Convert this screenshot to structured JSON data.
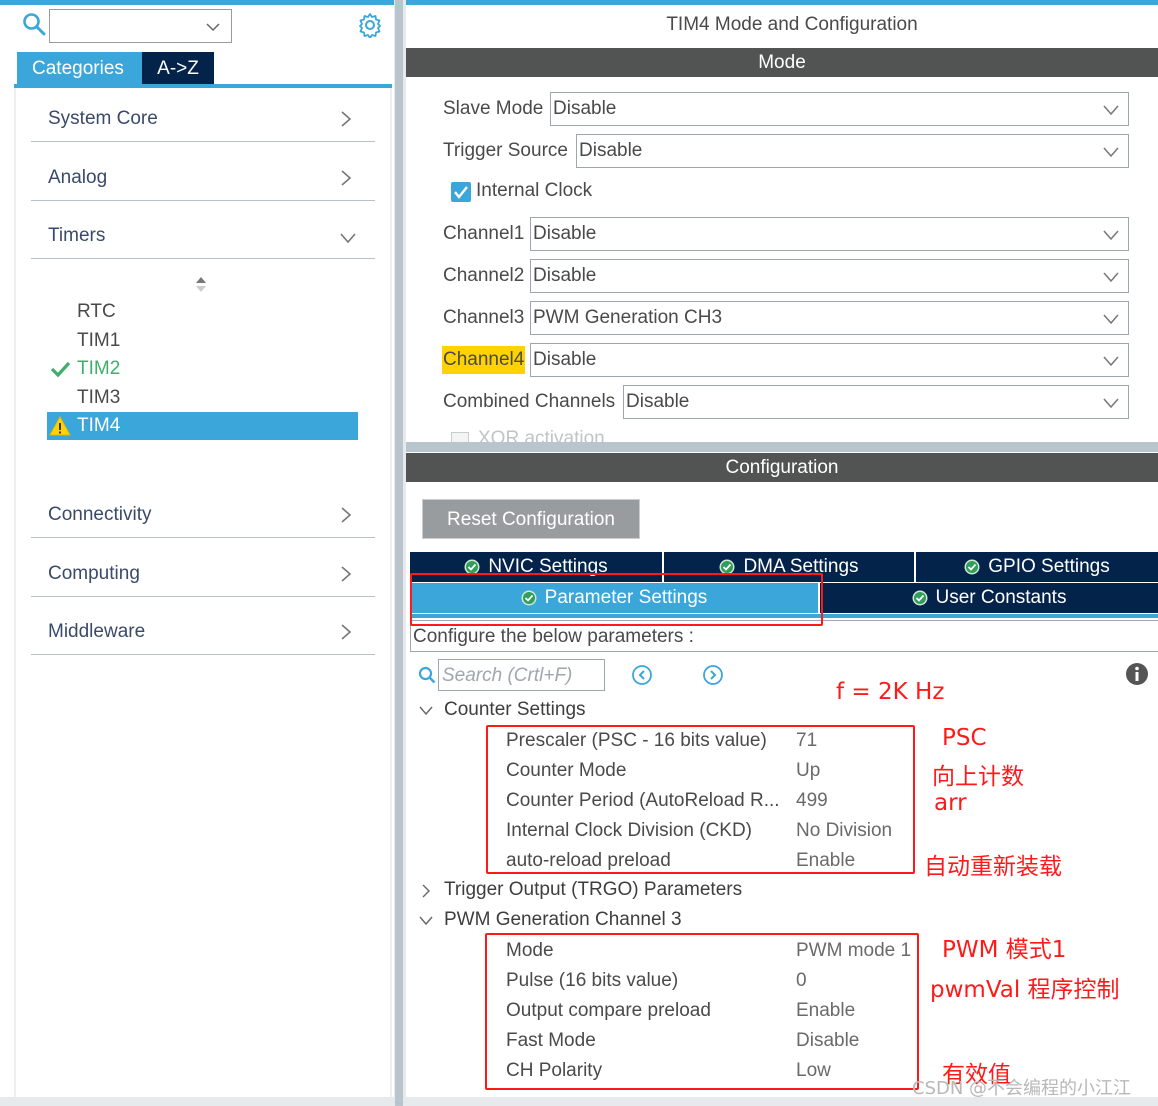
{
  "left_panel": {
    "search": {
      "value": "",
      "placeholder": ""
    },
    "tabs": [
      {
        "label": "Categories",
        "active": true
      },
      {
        "label": "A->Z",
        "active": false
      }
    ],
    "categories": [
      {
        "label": "System Core",
        "expanded": false
      },
      {
        "label": "Analog",
        "expanded": false
      },
      {
        "label": "Timers",
        "expanded": true
      },
      {
        "label": "Connectivity",
        "expanded": false
      },
      {
        "label": "Computing",
        "expanded": false
      },
      {
        "label": "Middleware",
        "expanded": false
      }
    ],
    "timers": [
      {
        "label": "RTC",
        "status": "none"
      },
      {
        "label": "TIM1",
        "status": "none"
      },
      {
        "label": "TIM2",
        "status": "ok"
      },
      {
        "label": "TIM3",
        "status": "none"
      },
      {
        "label": "TIM4",
        "status": "warning",
        "selected": true
      }
    ]
  },
  "right_panel": {
    "title": "TIM4 Mode and Configuration",
    "mode_header": "Mode",
    "mode": {
      "slave_mode": {
        "label": "Slave Mode",
        "value": "Disable"
      },
      "trigger_source": {
        "label": "Trigger Source",
        "value": "Disable"
      },
      "internal_clock": {
        "label": "Internal Clock",
        "checked": true
      },
      "channel1": {
        "label": "Channel1",
        "value": "Disable"
      },
      "channel2": {
        "label": "Channel2",
        "value": "Disable"
      },
      "channel3": {
        "label": "Channel3",
        "value": "PWM Generation CH3"
      },
      "channel4": {
        "label": "Channel4",
        "value": "Disable",
        "highlighted": true
      },
      "combined_channels": {
        "label": "Combined Channels",
        "value": "Disable"
      },
      "xor_activation": {
        "label": "XOR activation",
        "checked": false
      }
    },
    "config_header": "Configuration",
    "reset_button": "Reset Configuration",
    "tabs_row1": [
      {
        "label": "NVIC Settings"
      },
      {
        "label": "DMA Settings"
      },
      {
        "label": "GPIO Settings"
      }
    ],
    "tabs_row2": [
      {
        "label": "Parameter Settings",
        "active": true
      },
      {
        "label": "User Constants",
        "active": false
      }
    ],
    "configure_text": "Configure the below parameters :",
    "param_search_placeholder": "Search (Crtl+F)",
    "groups": {
      "counter": {
        "label": "Counter Settings",
        "expanded": true,
        "params": [
          {
            "name": "Prescaler (PSC - 16 bits value)",
            "value": "71"
          },
          {
            "name": "Counter Mode",
            "value": "Up"
          },
          {
            "name": "Counter Period (AutoReload R...",
            "value": "499"
          },
          {
            "name": "Internal Clock Division (CKD)",
            "value": "No Division"
          },
          {
            "name": "auto-reload preload",
            "value": "Enable"
          }
        ]
      },
      "trgo": {
        "label": "Trigger Output (TRGO) Parameters",
        "expanded": false
      },
      "pwm": {
        "label": "PWM Generation Channel 3",
        "expanded": true,
        "params": [
          {
            "name": "Mode",
            "value": "PWM mode 1"
          },
          {
            "name": "Pulse (16 bits value)",
            "value": "0"
          },
          {
            "name": "Output compare preload",
            "value": "Enable"
          },
          {
            "name": "Fast Mode",
            "value": "Disable"
          },
          {
            "name": "CH Polarity",
            "value": "Low"
          }
        ]
      }
    }
  },
  "annotations": {
    "freq": "f = 2K Hz",
    "psc": "PSC",
    "count_up": "向上计数",
    "arr": "arr",
    "auto_reload": "自动重新装载",
    "pwm_mode": "PWM 模式1",
    "pwm_val": "pwmVal 程序控制",
    "polarity": "有效值",
    "watermark": "CSDN @不会编程的小江江"
  },
  "colors": {
    "accent": "#3ba6da",
    "dark_tab": "#03234b",
    "header_bar": "#525454",
    "ok_green": "#3fae6a",
    "warning_yellow": "#ffd200",
    "annotation_red": "#ff1a1a"
  }
}
